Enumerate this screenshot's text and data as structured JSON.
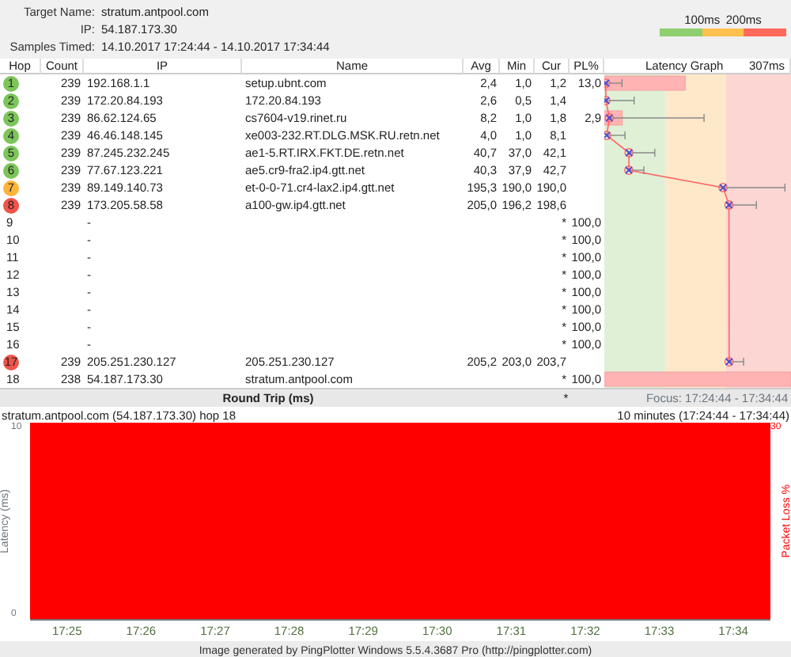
{
  "target": {
    "name_label": "Target Name:",
    "name": "stratum.antpool.com",
    "ip_label": "IP:",
    "ip": "54.187.173.30",
    "samples_label": "Samples Timed:",
    "samples": "14.10.2017 17:24:44 - 14.10.2017 17:34:44"
  },
  "legend": [
    {
      "label": "100ms",
      "color": "#8fcf6f"
    },
    {
      "label": "200ms",
      "color": "#ffc04d"
    },
    {
      "color": "#ff6a5a"
    }
  ],
  "columns": [
    "Hop",
    "Count",
    "IP",
    "Name",
    "Avg",
    "Min",
    "Cur",
    "PL%"
  ],
  "hops": [
    {
      "hop": "1",
      "color": "#7cc55a",
      "count": "239",
      "ip": "192.168.1.1",
      "name": "setup.ubnt.com",
      "avg": "2,4",
      "min": "1,0",
      "cur": "1,2",
      "pl": "13,0"
    },
    {
      "hop": "2",
      "color": "#7cc55a",
      "count": "239",
      "ip": "172.20.84.193",
      "name": "172.20.84.193",
      "avg": "2,6",
      "min": "0,5",
      "cur": "1,4"
    },
    {
      "hop": "3",
      "color": "#7cc55a",
      "count": "239",
      "ip": "86.62.124.65",
      "name": "cs7604-v19.rinet.ru",
      "avg": "8,2",
      "min": "1,0",
      "cur": "1,8",
      "pl": "2,9"
    },
    {
      "hop": "4",
      "color": "#7cc55a",
      "count": "239",
      "ip": "46.46.148.145",
      "name": "xe003-232.RT.DLG.MSK.RU.retn.net",
      "avg": "4,0",
      "min": "1,0",
      "cur": "8,1"
    },
    {
      "hop": "5",
      "color": "#7cc55a",
      "count": "239",
      "ip": "87.245.232.245",
      "name": "ae1-5.RT.IRX.FKT.DE.retn.net",
      "avg": "40,7",
      "min": "37,0",
      "cur": "42,1"
    },
    {
      "hop": "6",
      "color": "#7cc55a",
      "count": "239",
      "ip": "77.67.123.221",
      "name": "ae5.cr9-fra2.ip4.gtt.net",
      "avg": "40,3",
      "min": "37,9",
      "cur": "42,7"
    },
    {
      "hop": "7",
      "color": "#ffb43a",
      "count": "239",
      "ip": "89.149.140.73",
      "name": "et-0-0-71.cr4-lax2.ip4.gtt.net",
      "avg": "195,3",
      "min": "190,0",
      "cur": "190,0"
    },
    {
      "hop": "8",
      "color": "#f0544a",
      "count": "239",
      "ip": "173.205.58.58",
      "name": "a100-gw.ip4.gtt.net",
      "avg": "205,0",
      "min": "196,2",
      "cur": "198,6"
    },
    {
      "hop": "9",
      "ip": "-",
      "cur": "*",
      "pl": "100,0"
    },
    {
      "hop": "10",
      "ip": "-",
      "cur": "*",
      "pl": "100,0"
    },
    {
      "hop": "11",
      "ip": "-",
      "cur": "*",
      "pl": "100,0"
    },
    {
      "hop": "12",
      "ip": "-",
      "cur": "*",
      "pl": "100,0"
    },
    {
      "hop": "13",
      "ip": "-",
      "cur": "*",
      "pl": "100,0"
    },
    {
      "hop": "14",
      "ip": "-",
      "cur": "*",
      "pl": "100,0"
    },
    {
      "hop": "15",
      "ip": "-",
      "cur": "*",
      "pl": "100,0"
    },
    {
      "hop": "16",
      "ip": "-",
      "cur": "*",
      "pl": "100,0"
    },
    {
      "hop": "17",
      "color": "#f0544a",
      "count": "239",
      "ip": "205.251.230.127",
      "name": "205.251.230.127",
      "avg": "205,2",
      "min": "203,0",
      "cur": "203,7"
    },
    {
      "hop": "18",
      "count": "238",
      "ip": "54.187.173.30",
      "name": "stratum.antpool.com",
      "cur": "*",
      "pl": "100,0"
    }
  ],
  "latency_graph": {
    "title": "Latency Graph",
    "max_label": "307ms"
  },
  "summary": {
    "label": "Round Trip (ms)",
    "cur": "*",
    "focus": "Focus: 17:24:44 - 17:34:44"
  },
  "timeline": {
    "title": "stratum.antpool.com (54.187.173.30) hop 18",
    "range": "10 minutes (17:24:44 - 17:34:44)",
    "ylabel": "Latency (ms)",
    "left_ticks": [
      "10",
      "0"
    ],
    "right_label": "Packet Loss %",
    "right_tick": "30",
    "time_labels": [
      "17:25",
      "17:26",
      "17:27",
      "17:28",
      "17:29",
      "17:30",
      "17:31",
      "17:32",
      "17:33",
      "17:34"
    ]
  },
  "footer": "Image generated by PingPlotter Windows 5.5.4.3687 Pro (http://pingplotter.com)"
}
